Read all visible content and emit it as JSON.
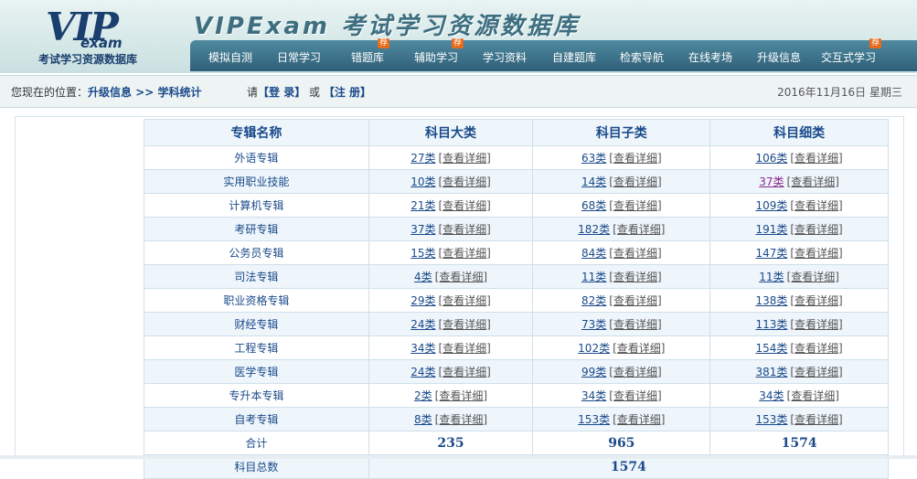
{
  "logo": {
    "vip": "VIP",
    "exam": "exam",
    "subtitle": "考试学习资源数据库"
  },
  "site_title": "VIPExam 考试学习资源数据库",
  "nav": [
    {
      "label": "模拟自测",
      "badge": ""
    },
    {
      "label": "日常学习",
      "badge": ""
    },
    {
      "label": "错题库",
      "badge": "荐"
    },
    {
      "label": "辅助学习",
      "badge": "荐"
    },
    {
      "label": "学习资料",
      "badge": ""
    },
    {
      "label": "自建题库",
      "badge": ""
    },
    {
      "label": "检索导航",
      "badge": ""
    },
    {
      "label": "在线考场",
      "badge": ""
    },
    {
      "label": "升级信息",
      "badge": ""
    },
    {
      "label": "交互式学习",
      "badge": "荐"
    }
  ],
  "location": {
    "prefix": "您现在的位置：",
    "crumb1": "升级信息",
    "sep": " >> ",
    "crumb2": "学科统计"
  },
  "auth": {
    "please": "请",
    "login": "【登 录】",
    "or": "或",
    "register": "【注 册】"
  },
  "date": "2016年11月16日 星期三",
  "table": {
    "headers": [
      "专辑名称",
      "科目大类",
      "科目子类",
      "科目细类"
    ],
    "detail_label": "[查看详细]",
    "rows": [
      {
        "name": "外语专辑",
        "c1": "27类",
        "c2": "63类",
        "c3": "106类"
      },
      {
        "name": "实用职业技能",
        "c1": "10类",
        "c2": "14类",
        "c3": "37类"
      },
      {
        "name": "计算机专辑",
        "c1": "21类",
        "c2": "68类",
        "c3": "109类"
      },
      {
        "name": "考研专辑",
        "c1": "37类",
        "c2": "182类",
        "c3": "191类"
      },
      {
        "name": "公务员专辑",
        "c1": "15类",
        "c2": "84类",
        "c3": "147类"
      },
      {
        "name": "司法专辑",
        "c1": "4类",
        "c2": "11类",
        "c3": "11类"
      },
      {
        "name": "职业资格专辑",
        "c1": "29类",
        "c2": "82类",
        "c3": "138类"
      },
      {
        "name": "财经专辑",
        "c1": "24类",
        "c2": "73类",
        "c3": "113类"
      },
      {
        "name": "工程专辑",
        "c1": "34类",
        "c2": "102类",
        "c3": "154类"
      },
      {
        "name": "医学专辑",
        "c1": "24类",
        "c2": "99类",
        "c3": "381类"
      },
      {
        "name": "专升本专辑",
        "c1": "2类",
        "c2": "34类",
        "c3": "34类"
      },
      {
        "name": "自考专辑",
        "c1": "8类",
        "c2": "153类",
        "c3": "153类"
      }
    ],
    "total_label": "合计",
    "totals": [
      "235",
      "965",
      "1574"
    ],
    "grand_label": "科目总数",
    "grand_total": "1574"
  }
}
